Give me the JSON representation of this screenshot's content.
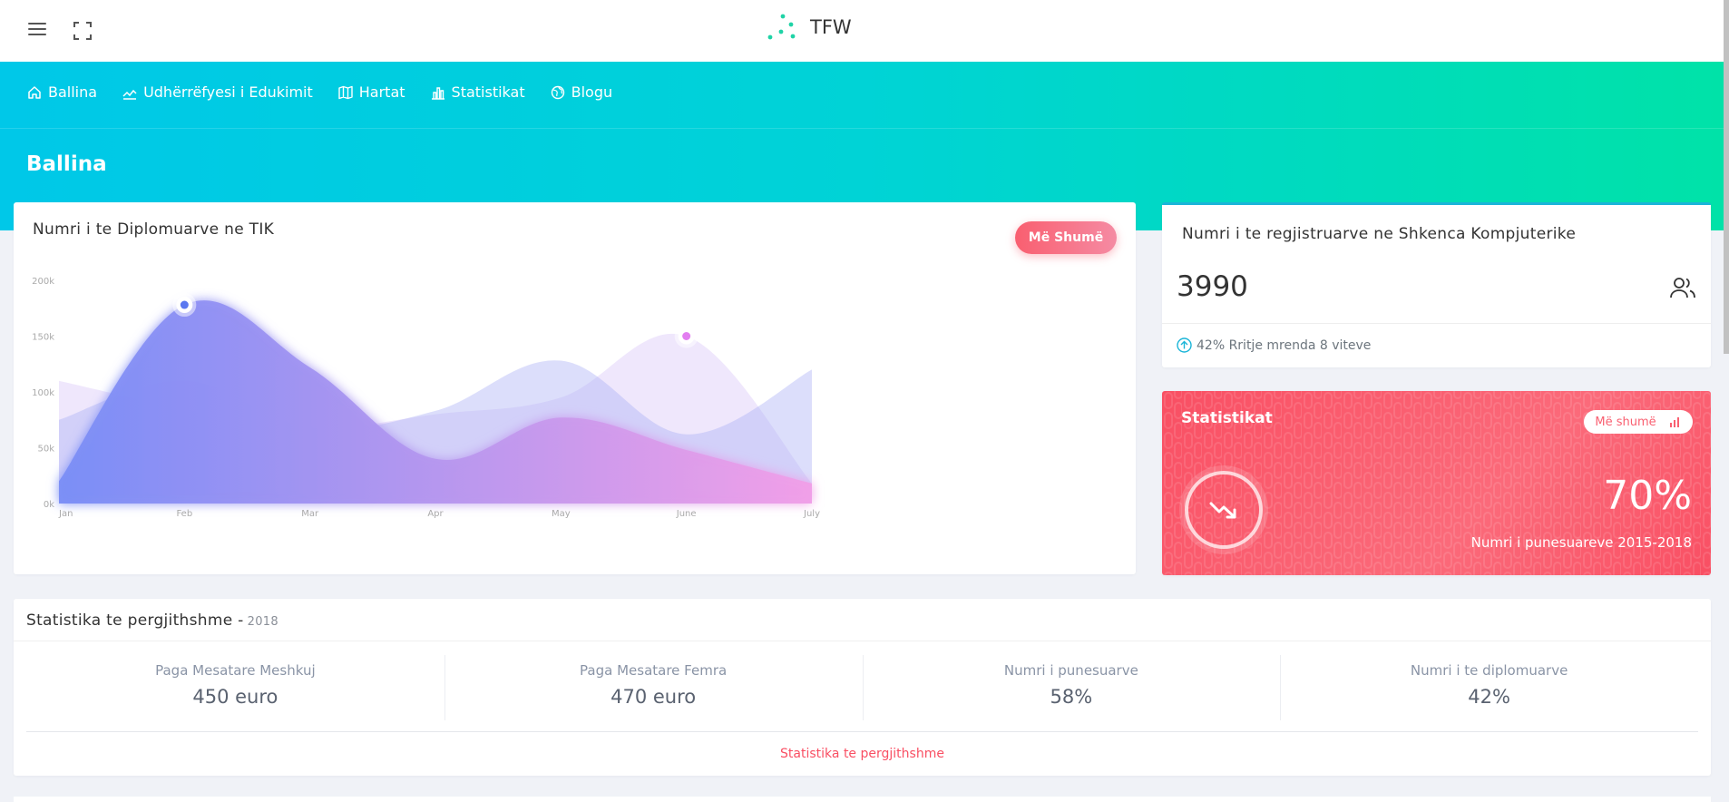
{
  "brand": {
    "name": "TFW",
    "accent": "#1fd3a6"
  },
  "nav": [
    {
      "label": "Ballina",
      "icon": "home-icon"
    },
    {
      "label": "Udhërrëfyesi i Edukimit",
      "icon": "trend-icon"
    },
    {
      "label": "Hartat",
      "icon": "map-icon"
    },
    {
      "label": "Statistikat",
      "icon": "bar-chart-icon"
    },
    {
      "label": "Blogu",
      "icon": "globe-icon"
    }
  ],
  "page": {
    "title": "Ballina"
  },
  "graduates_card": {
    "title": "Numri i te Diplomuarve ne TIK",
    "button": "Më Shumë"
  },
  "registered_card": {
    "title": "Numri i te regjistruarve ne Shkenca Kompjuterike",
    "value": "3990",
    "footer": "42% Rritje mrenda 8 viteve",
    "accent": "#1bb5d8"
  },
  "stats_card": {
    "title": "Statistikat",
    "button": "Më shumë",
    "percent": "70%",
    "description": "Numri i punesuareve 2015-2018",
    "color": "#f94f63"
  },
  "general": {
    "title": "Statistika te pergjithshme -",
    "year": "2018",
    "items": [
      {
        "label": "Paga Mesatare Meshkuj",
        "value": "450 euro"
      },
      {
        "label": "Paga Mesatare Femra",
        "value": "470 euro"
      },
      {
        "label": "Numri i punesuarve",
        "value": "58%"
      },
      {
        "label": "Numri i te diplomuarve",
        "value": "42%"
      }
    ],
    "link": "Statistika te pergjithshme"
  },
  "chart_data": {
    "type": "area",
    "categories": [
      "Jan",
      "Feb",
      "Mar",
      "Apr",
      "May",
      "June",
      "July"
    ],
    "x": [
      0,
      0.5,
      1,
      1.5,
      2,
      2.5,
      3,
      3.5,
      4,
      4.5,
      5,
      5.5,
      6
    ],
    "y_ticks": [
      "0k",
      "50k",
      "100k",
      "150k",
      "200k"
    ],
    "ylim": [
      0,
      200
    ],
    "series": [
      {
        "values": [
          20,
          178,
          122,
          40,
          77,
          48,
          18
        ],
        "color": "#7f8ff4"
      },
      {
        "values": [
          75,
          110,
          68,
          83,
          128,
          62,
          120
        ],
        "color": "#c7c9f7"
      },
      {
        "values": [
          110,
          85,
          67,
          80,
          95,
          150,
          18
        ],
        "color": "#e9defa"
      }
    ],
    "markers": [
      {
        "x": 1,
        "y": 178
      },
      {
        "x": 5,
        "y": 150
      }
    ],
    "title": "Numri i te Diplomuarve ne TIK",
    "xlabel": "",
    "ylabel": "",
    "grid": false
  }
}
